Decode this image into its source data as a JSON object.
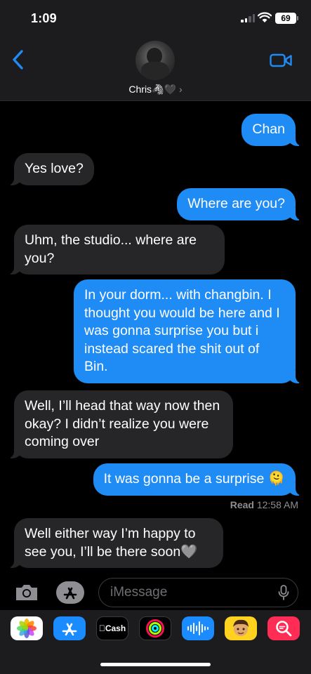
{
  "status": {
    "time": "1:09",
    "battery": "69"
  },
  "header": {
    "contact_name": "Chris🦓🖤",
    "chevron": "›"
  },
  "messages": [
    {
      "side": "sent",
      "text": "Chan"
    },
    {
      "side": "recv",
      "text": "Yes love?"
    },
    {
      "side": "sent",
      "text": "Where are you?"
    },
    {
      "side": "recv",
      "text": "Uhm, the studio... where are you?"
    },
    {
      "side": "sent",
      "text": "In your dorm... with changbin. I thought you would be here and I was gonna surprise you but i instead scared the shit out of Bin."
    },
    {
      "side": "recv",
      "text": "Well, I’ll head that way now then okay? I didn’t realize you were coming over"
    },
    {
      "side": "sent",
      "text": "It was gonna be a surprise 🫠"
    },
    {
      "side": "recv",
      "text": "Well either way I’m happy to see you, I’ll be there soon🩶"
    }
  ],
  "receipt": {
    "label": "Read",
    "time": "12:58 AM"
  },
  "input": {
    "placeholder": "iMessage"
  },
  "apps": [
    {
      "name": "photos-icon",
      "bg": "#ffffff"
    },
    {
      "name": "app-store-icon",
      "bg": "#1a8cff"
    },
    {
      "name": "apple-cash-icon",
      "bg": "#000000",
      "label": "Cash"
    },
    {
      "name": "activity-icon",
      "bg": "#000000"
    },
    {
      "name": "audio-message-icon",
      "bg": "#1a8cff"
    },
    {
      "name": "memoji-icon",
      "bg": "#ffd21f"
    },
    {
      "name": "images-search-icon",
      "bg": "#ff2d55"
    }
  ]
}
